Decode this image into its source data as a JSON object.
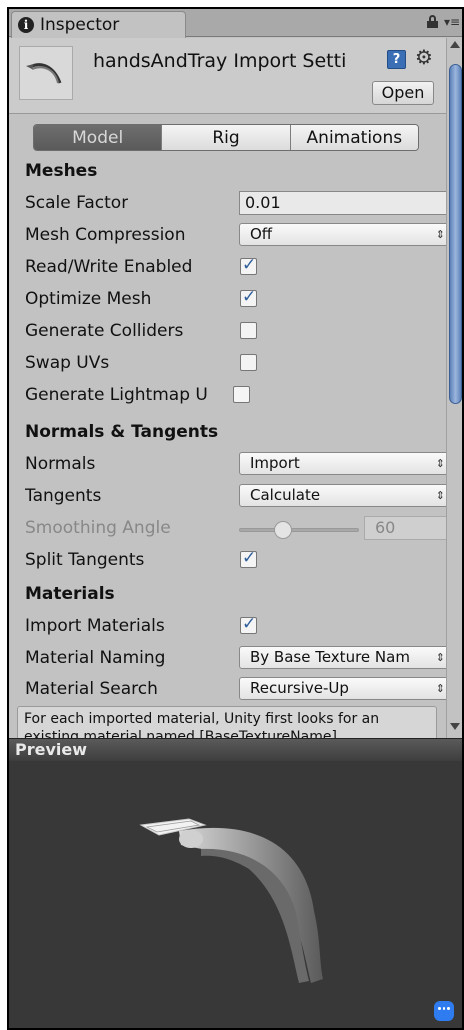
{
  "tab": {
    "label": "Inspector"
  },
  "header": {
    "title": "handsAndTray Import Setti",
    "open_label": "Open",
    "help_label": "?",
    "icons": [
      "info-icon",
      "lock-icon",
      "menu-icon",
      "help-icon",
      "gear-icon"
    ]
  },
  "tabs": [
    {
      "label": "Model",
      "active": true
    },
    {
      "label": "Rig",
      "active": false
    },
    {
      "label": "Animations",
      "active": false
    }
  ],
  "meshes": {
    "heading": "Meshes",
    "scale_factor": {
      "label": "Scale Factor",
      "value": "0.01"
    },
    "mesh_compression": {
      "label": "Mesh Compression",
      "value": "Off"
    },
    "read_write": {
      "label": "Read/Write Enabled",
      "checked": true
    },
    "optimize_mesh": {
      "label": "Optimize Mesh",
      "checked": true
    },
    "generate_colliders": {
      "label": "Generate Colliders",
      "checked": false
    },
    "swap_uvs": {
      "label": "Swap UVs",
      "checked": false
    },
    "generate_lightmap": {
      "label": "Generate Lightmap U",
      "checked": false
    }
  },
  "normals_tangents": {
    "heading": "Normals & Tangents",
    "normals": {
      "label": "Normals",
      "value": "Import"
    },
    "tangents": {
      "label": "Tangents",
      "value": "Calculate"
    },
    "smoothing_angle": {
      "label": "Smoothing Angle",
      "value": "60"
    },
    "split_tangents": {
      "label": "Split Tangents",
      "checked": true
    }
  },
  "materials": {
    "heading": "Materials",
    "import_materials": {
      "label": "Import Materials",
      "checked": true
    },
    "material_naming": {
      "label": "Material Naming",
      "value": "By Base Texture Nam"
    },
    "material_search": {
      "label": "Material Search",
      "value": "Recursive-Up"
    },
    "help_text": "For each imported material, Unity first looks for an existing material named [BaseTextureName]."
  },
  "preview": {
    "label": "Preview"
  },
  "colors": {
    "accent": "#3a6fb5",
    "active_tab": "#5f5f5f",
    "preview_bg": "#383838"
  }
}
